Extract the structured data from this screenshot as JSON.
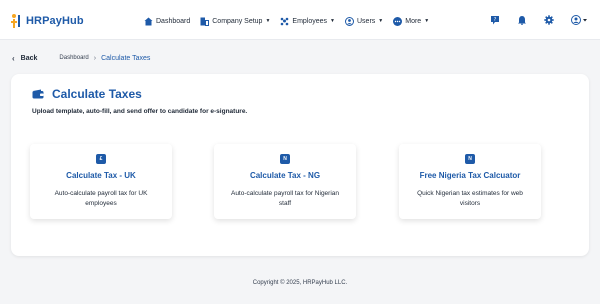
{
  "brand": {
    "name": "HRPayHub"
  },
  "nav": {
    "dashboard": "Dashboard",
    "company_setup": "Company Setup",
    "employees": "Employees",
    "users": "Users",
    "more": "More"
  },
  "breadcrumb": {
    "back": "Back",
    "dashboard": "Dashboard",
    "current": "Calculate Taxes"
  },
  "page": {
    "title": "Calculate Taxes",
    "subtitle": "Upload template, auto-fill, and send offer to candidate for e-signature."
  },
  "tiles": [
    {
      "badge": "£",
      "title": "Calculate Tax - UK",
      "desc": "Auto-calculate payroll tax for UK employees"
    },
    {
      "badge": "N",
      "title": "Calculate Tax - NG",
      "desc": "Auto-calculate payroll tax for Nigerian staff"
    },
    {
      "badge": "N",
      "title": "Free Nigeria Tax Calcuator",
      "desc": "Quick Nigerian tax estimates for web visitors"
    }
  ],
  "footer": {
    "copyright": "Copyright © 2025, HRPayHub LLC."
  },
  "colors": {
    "primary": "#1e5aa8",
    "logo_accent": "#f5a623"
  },
  "icons": {
    "dashboard": "home-icon",
    "company_setup": "building-icon",
    "employees": "people-icon",
    "users": "user-circle-icon",
    "more": "ellipsis-circle-icon",
    "help": "help-icon",
    "notifications": "bell-icon",
    "settings": "gear-icon",
    "account": "account-icon",
    "title": "wallet-icon"
  }
}
